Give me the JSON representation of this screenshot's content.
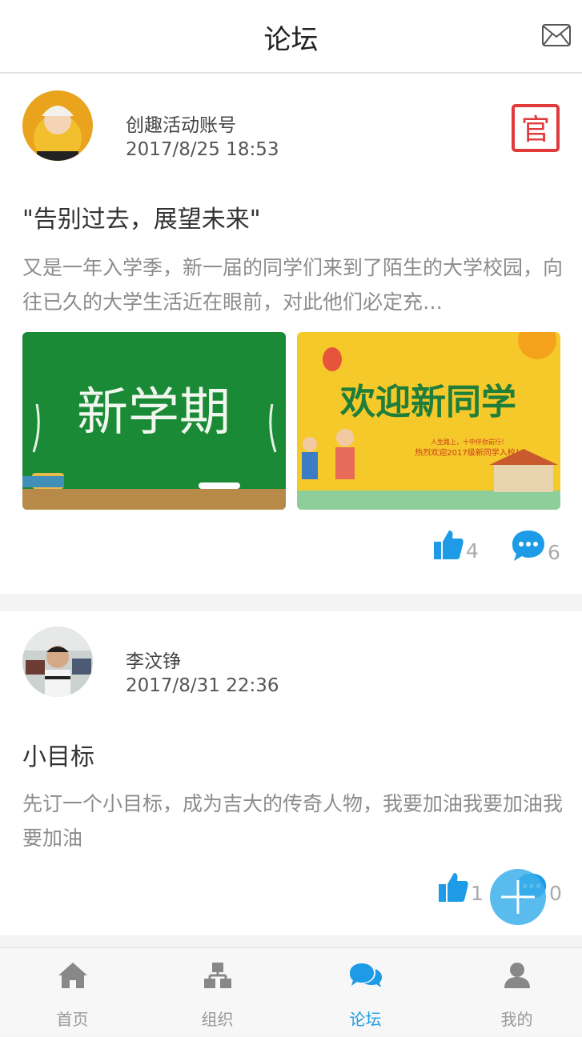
{
  "header": {
    "title": "论坛"
  },
  "posts": [
    {
      "author": "创趣活动账号",
      "time": "2017/8/25 18:53",
      "badge": "官",
      "title": "\"告别过去，展望未来\"",
      "body": "又是一年入学季，新一届的同学们来到了陌生的大学校园，向往已久的大学生活近在眼前，对此他们必定充…",
      "images": [
        {
          "text": "新学期"
        },
        {
          "text": "欢迎新同学",
          "line1": "人生路上，十中伴你前行！",
          "line2": "热烈欢迎2017级新同学入校！"
        }
      ],
      "likes": "4",
      "comments": "6"
    },
    {
      "author": "李汶铮",
      "time": "2017/8/31 22:36",
      "title": "小目标",
      "body": "先订一个小目标，成为吉大的传奇人物，我要加油我要加油我要加油",
      "likes": "1",
      "comments": "0"
    }
  ],
  "tabs": [
    {
      "label": "首页",
      "icon": "home-icon"
    },
    {
      "label": "组织",
      "icon": "org-icon"
    },
    {
      "label": "论坛",
      "icon": "forum-icon",
      "active": true
    },
    {
      "label": "我的",
      "icon": "user-icon"
    }
  ],
  "colors": {
    "accent": "#1d9be6",
    "badge": "#e03a3a",
    "text_muted": "#8c8c8c"
  }
}
